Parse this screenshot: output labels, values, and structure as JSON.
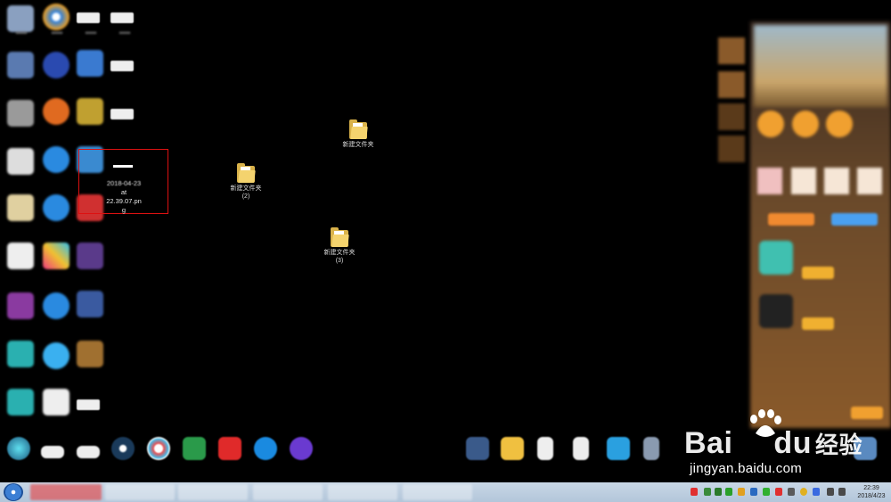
{
  "desktop": {
    "screenshot_file": {
      "name_line1": "2018-04-23",
      "name_line2": "at",
      "name_line3": "22.39.07.pn",
      "name_line4": "g"
    },
    "folders": [
      {
        "name": "新建文件夹",
        "suffix": ""
      },
      {
        "name": "新建文件夹",
        "suffix": "(2)"
      },
      {
        "name": "新建文件夹",
        "suffix": "(3)"
      }
    ]
  },
  "watermark": {
    "logo_text": "Bai",
    "logo_text2": "du",
    "brand_cn": "经验",
    "url": "jingyan.baidu.com"
  },
  "taskbar": {
    "clock_time": "22:39",
    "clock_date": "2018/4/23"
  },
  "colors": {
    "highlight_border": "#dd1111",
    "folder_yellow": "#f4d36e",
    "taskbar": "#c9d7e6"
  },
  "icons": [
    "folder-icon",
    "steam-icon",
    "start-orb-icon",
    "baidu-paw-icon"
  ]
}
